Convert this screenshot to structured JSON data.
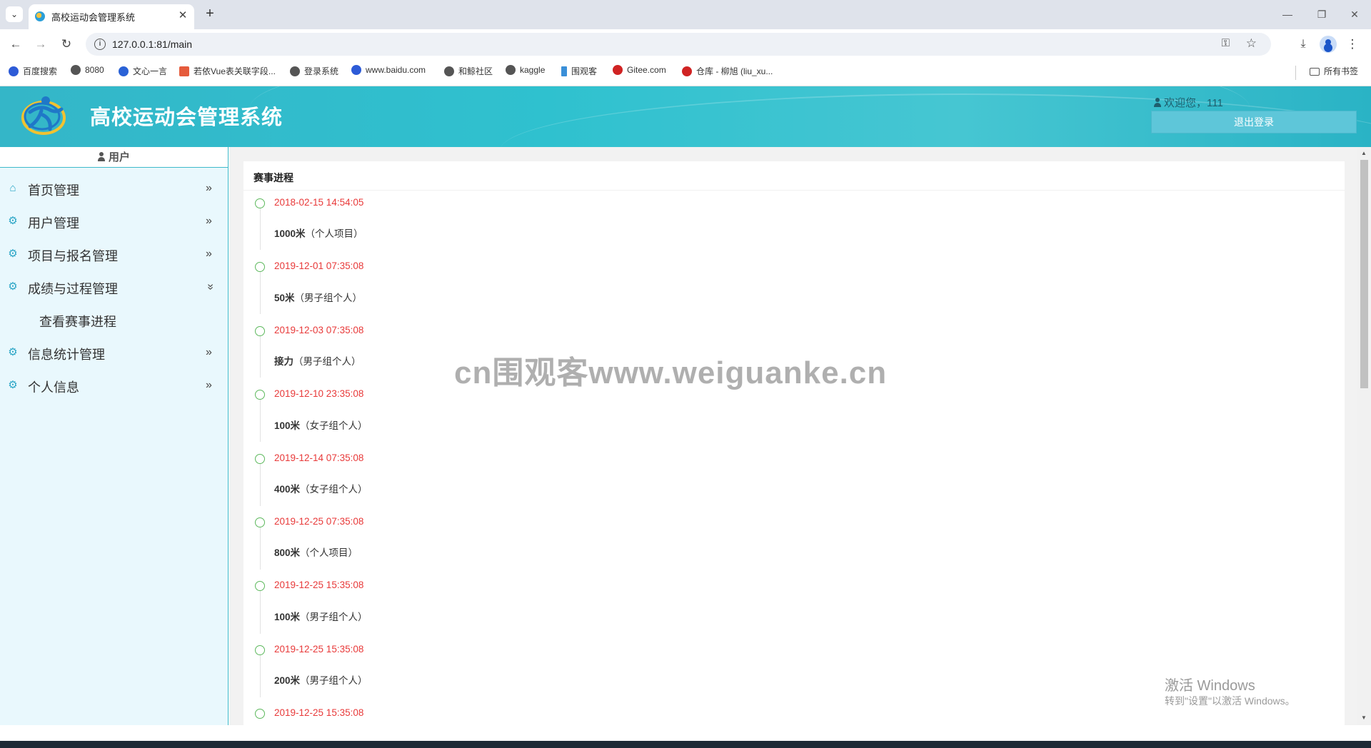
{
  "browser": {
    "tab_title": "高校运动会管理系统",
    "url": "127.0.0.1:81/main",
    "bookmarks": [
      {
        "label": "百度搜索",
        "icon": "paw-icon",
        "color": "#2d5bd7"
      },
      {
        "label": "8080",
        "icon": "globe-icon",
        "color": "#555555"
      },
      {
        "label": "文心一言",
        "icon": "cube-icon",
        "color": "#2a62d6"
      },
      {
        "label": "若依Vue表关联字段...",
        "icon": "jian-icon",
        "color": "#e55b3c"
      },
      {
        "label": "登录系统",
        "icon": "globe-icon",
        "color": "#555555"
      },
      {
        "label": "www.baidu.com",
        "icon": "paw-icon",
        "color": "#2d5bd7"
      },
      {
        "label": "和鲸社区",
        "icon": "globe-icon",
        "color": "#555555"
      },
      {
        "label": "kaggle",
        "icon": "globe-icon",
        "color": "#555555"
      },
      {
        "label": "围观客",
        "icon": "bookmark-icon",
        "color": "#3a8fd8"
      },
      {
        "label": "Gitee.com",
        "icon": "gitee-icon",
        "color": "#d02323"
      },
      {
        "label": "仓库 - 柳旭 (liu_xu...",
        "icon": "gitee-icon",
        "color": "#d02323"
      }
    ],
    "all_bookmarks": "所有书签"
  },
  "header": {
    "title": "高校运动会管理系统",
    "welcome": "欢迎您，111",
    "logout": "退出登录"
  },
  "sidebar": {
    "user_label": "用户",
    "menu": [
      {
        "label": "首页管理",
        "icon": "home-icon",
        "expanded": false
      },
      {
        "label": "用户管理",
        "icon": "gear-icon",
        "expanded": false
      },
      {
        "label": "项目与报名管理",
        "icon": "gear-icon",
        "expanded": false
      },
      {
        "label": "成绩与过程管理",
        "icon": "gear-icon",
        "expanded": true
      },
      {
        "label": "信息统计管理",
        "icon": "gear-icon",
        "expanded": false
      },
      {
        "label": "个人信息",
        "icon": "gear-icon",
        "expanded": false
      }
    ],
    "submenu": {
      "label": "查看赛事进程"
    }
  },
  "main": {
    "panel_title": "赛事进程",
    "timeline": [
      {
        "time": "2018-02-15 14:54:05",
        "name": "1000米",
        "group": "（个人项目）"
      },
      {
        "time": "2019-12-01 07:35:08",
        "name": "50米",
        "group": "（男子组个人）"
      },
      {
        "time": "2019-12-03 07:35:08",
        "name": "接力",
        "group": "（男子组个人）"
      },
      {
        "time": "2019-12-10 23:35:08",
        "name": "100米",
        "group": "（女子组个人）"
      },
      {
        "time": "2019-12-14 07:35:08",
        "name": "400米",
        "group": "（女子组个人）"
      },
      {
        "time": "2019-12-25 07:35:08",
        "name": "800米",
        "group": "（个人项目）"
      },
      {
        "time": "2019-12-25 15:35:08",
        "name": "100米",
        "group": "（男子组个人）"
      },
      {
        "time": "2019-12-25 15:35:08",
        "name": "200米",
        "group": "（男子组个人）"
      },
      {
        "time": "2019-12-25 15:35:08",
        "name": "",
        "group": ""
      }
    ]
  },
  "watermarks": {
    "site": "cn围观客www.weiguanke.cn",
    "activate_title": "激活 Windows",
    "activate_sub": "转到\"设置\"以激活 Windows。"
  },
  "colors": {
    "header": "#34b6c8",
    "sidebar_bg": "#e9f8fd",
    "accent": "#2aa5c6",
    "timeline_time": "#e83939",
    "timeline_dot": "#5cb85c"
  }
}
